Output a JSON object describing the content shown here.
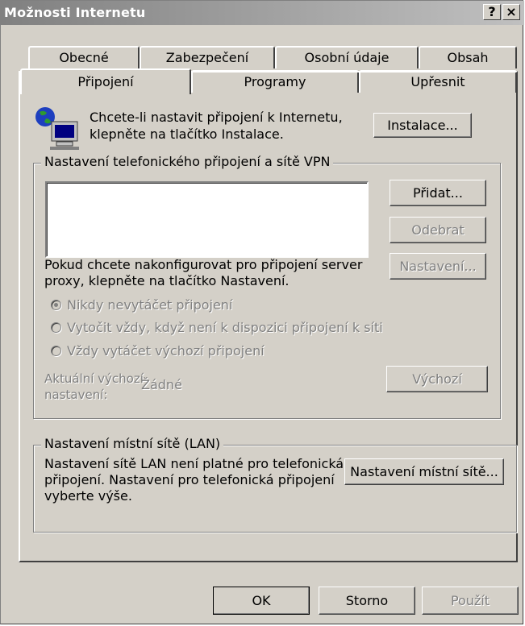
{
  "window": {
    "title": "Možnosti Internetu",
    "help_button": "?",
    "close_button": "×"
  },
  "tabs": {
    "row_back": [
      "Obecné",
      "Zabezpečení",
      "Osobní údaje",
      "Obsah"
    ],
    "row_front": [
      "Připojení",
      "Programy",
      "Upřesnit"
    ],
    "active": "Připojení"
  },
  "setup": {
    "text_line1": "Chcete-li nastavit připojení k Internetu,",
    "text_line2": "klepněte na tlačítko Instalace.",
    "install_button": "Instalace..."
  },
  "dialup": {
    "group_title": "Nastavení telefonického připojení a sítě VPN",
    "add_button": "Přidat...",
    "remove_button": "Odebrat",
    "proxy_text_line1": "Pokud chcete nakonfigurovat pro připojení server",
    "proxy_text_line2": "proxy, klepněte na tlačítko Nastavení.",
    "settings_button": "Nastavení...",
    "radio_options": [
      "Nikdy nevytáčet připojení",
      "Vytočit vždy, když není k dispozici připojení k síti",
      "Vždy vytáčet výchozí připojení"
    ],
    "selected_option": "Nikdy nevytáčet připojení",
    "default_label_line1": "Aktuální výchozí",
    "default_label_line2": "nastavení:",
    "default_value": "Žádné",
    "default_button": "Výchozí"
  },
  "lan": {
    "group_title": "Nastavení místní sítě (LAN)",
    "text_line1": "Nastavení sítě LAN není platné pro telefonická",
    "text_line2": "připojení. Nastavení pro telefonická připojení",
    "text_line3": "vyberte výše.",
    "lan_button": "Nastavení místní sítě..."
  },
  "footer": {
    "ok_button": "OK",
    "cancel_button": "Storno",
    "apply_button": "Použít"
  },
  "colors": {
    "face": "#d4d0c8",
    "shadow": "#808080",
    "highlight": "#ffffff",
    "dark": "#404040"
  }
}
